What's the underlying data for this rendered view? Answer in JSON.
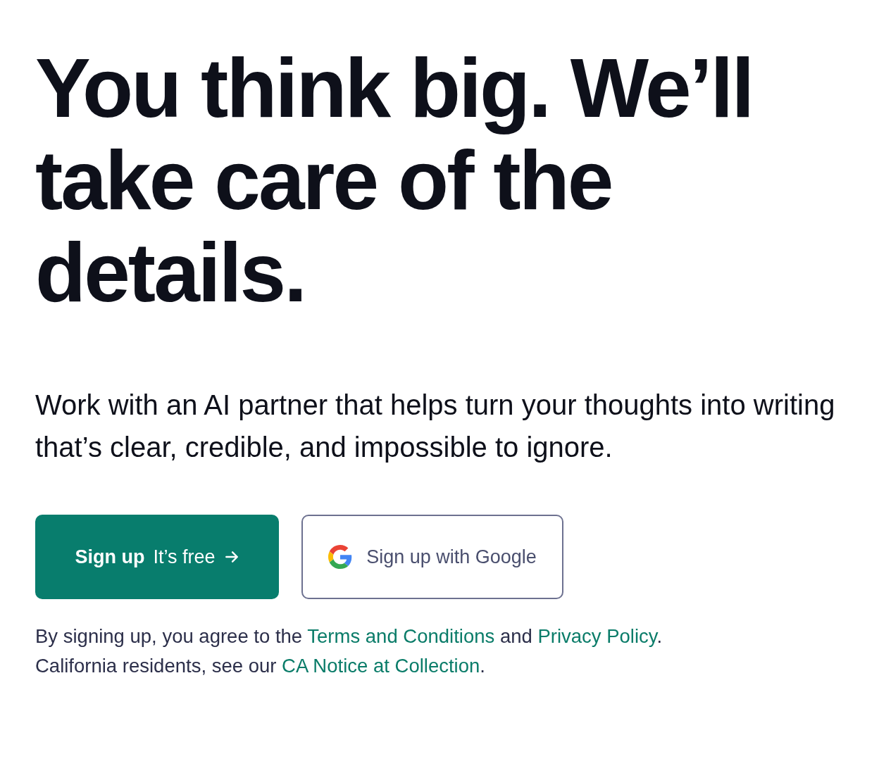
{
  "headline": "You think big. We’ll take care of the details.",
  "subheading": "Work with an AI partner that helps turn your thoughts into writing that’s clear, credible, and impossible to ignore.",
  "buttons": [
    {
      "kind": "primary",
      "label": "Sign up",
      "note": "It’s free"
    },
    {
      "kind": "google",
      "label": "Sign up with Google"
    }
  ],
  "legal": [
    {
      "parts": [
        {
          "kind": "text",
          "text": "By signing up, you agree to the "
        },
        {
          "kind": "link",
          "text": "Terms and Conditions"
        },
        {
          "kind": "text",
          "text": " and "
        },
        {
          "kind": "link",
          "text": "Privacy Policy"
        },
        {
          "kind": "text",
          "text": "."
        }
      ]
    },
    {
      "parts": [
        {
          "kind": "text",
          "text": "California residents, see our "
        },
        {
          "kind": "link",
          "text": "CA Notice at Collection"
        },
        {
          "kind": "text",
          "text": "."
        }
      ]
    }
  ]
}
